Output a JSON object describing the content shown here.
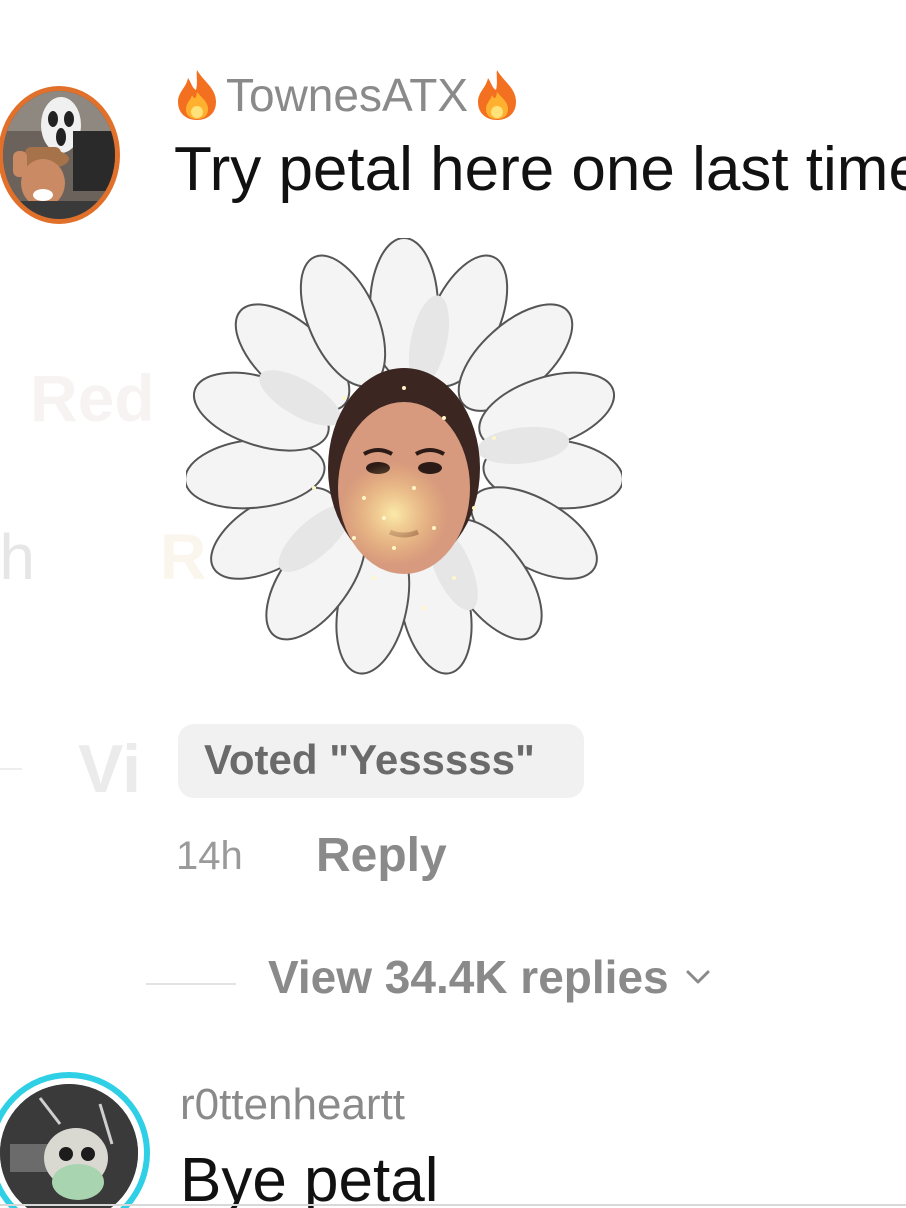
{
  "ghost_texts": {
    "red": "Red",
    "h": "-h",
    "r": "R",
    "vi": "Vi"
  },
  "comment_1": {
    "username": "TownesATX",
    "username_decoration": "fire-emoji",
    "text": "Try petal here one last time",
    "sticker": "daisy-face-sticker",
    "vote_label": "Voted \"Yesssss\"",
    "time": "14h",
    "reply_label": "Reply",
    "view_replies_label": "View 34.4K replies"
  },
  "comment_2": {
    "username": "r0ttenheartt",
    "text": "Bye petal"
  },
  "colors": {
    "avatar_ring_1": "#e0702a",
    "avatar_ring_2": "#2fd0e6",
    "muted_text": "#8a8a8a",
    "primary_text": "#111111"
  },
  "icons": [
    "fire-icon",
    "chevron-down-icon"
  ]
}
